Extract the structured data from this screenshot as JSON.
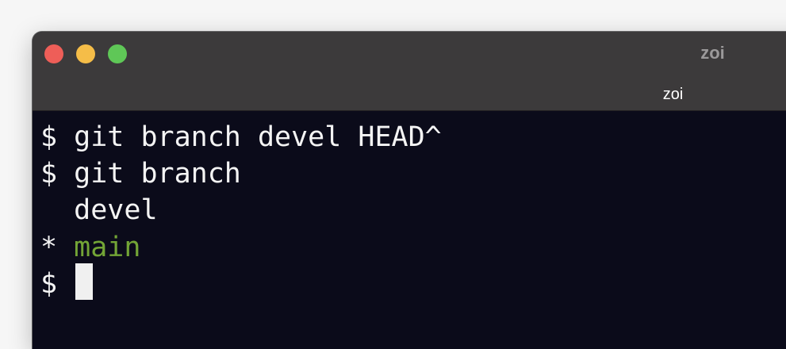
{
  "window": {
    "title": "zoi",
    "tab_title": "zoi",
    "traffic_lights": {
      "close_color": "#ee5e58",
      "minimize_color": "#f5bd48",
      "zoom_color": "#5fc757"
    }
  },
  "terminal": {
    "background_color": "#0b0b1a",
    "text_color": "#f4f4f4",
    "highlight_color": "#73a536",
    "lines": [
      {
        "prompt": "$ ",
        "text": "git branch devel HEAD^"
      },
      {
        "prompt": "$ ",
        "text": "git branch"
      },
      {
        "prompt": "  ",
        "text": "devel"
      },
      {
        "prompt": "* ",
        "text": "main"
      },
      {
        "prompt": "$ ",
        "text": ""
      }
    ]
  }
}
